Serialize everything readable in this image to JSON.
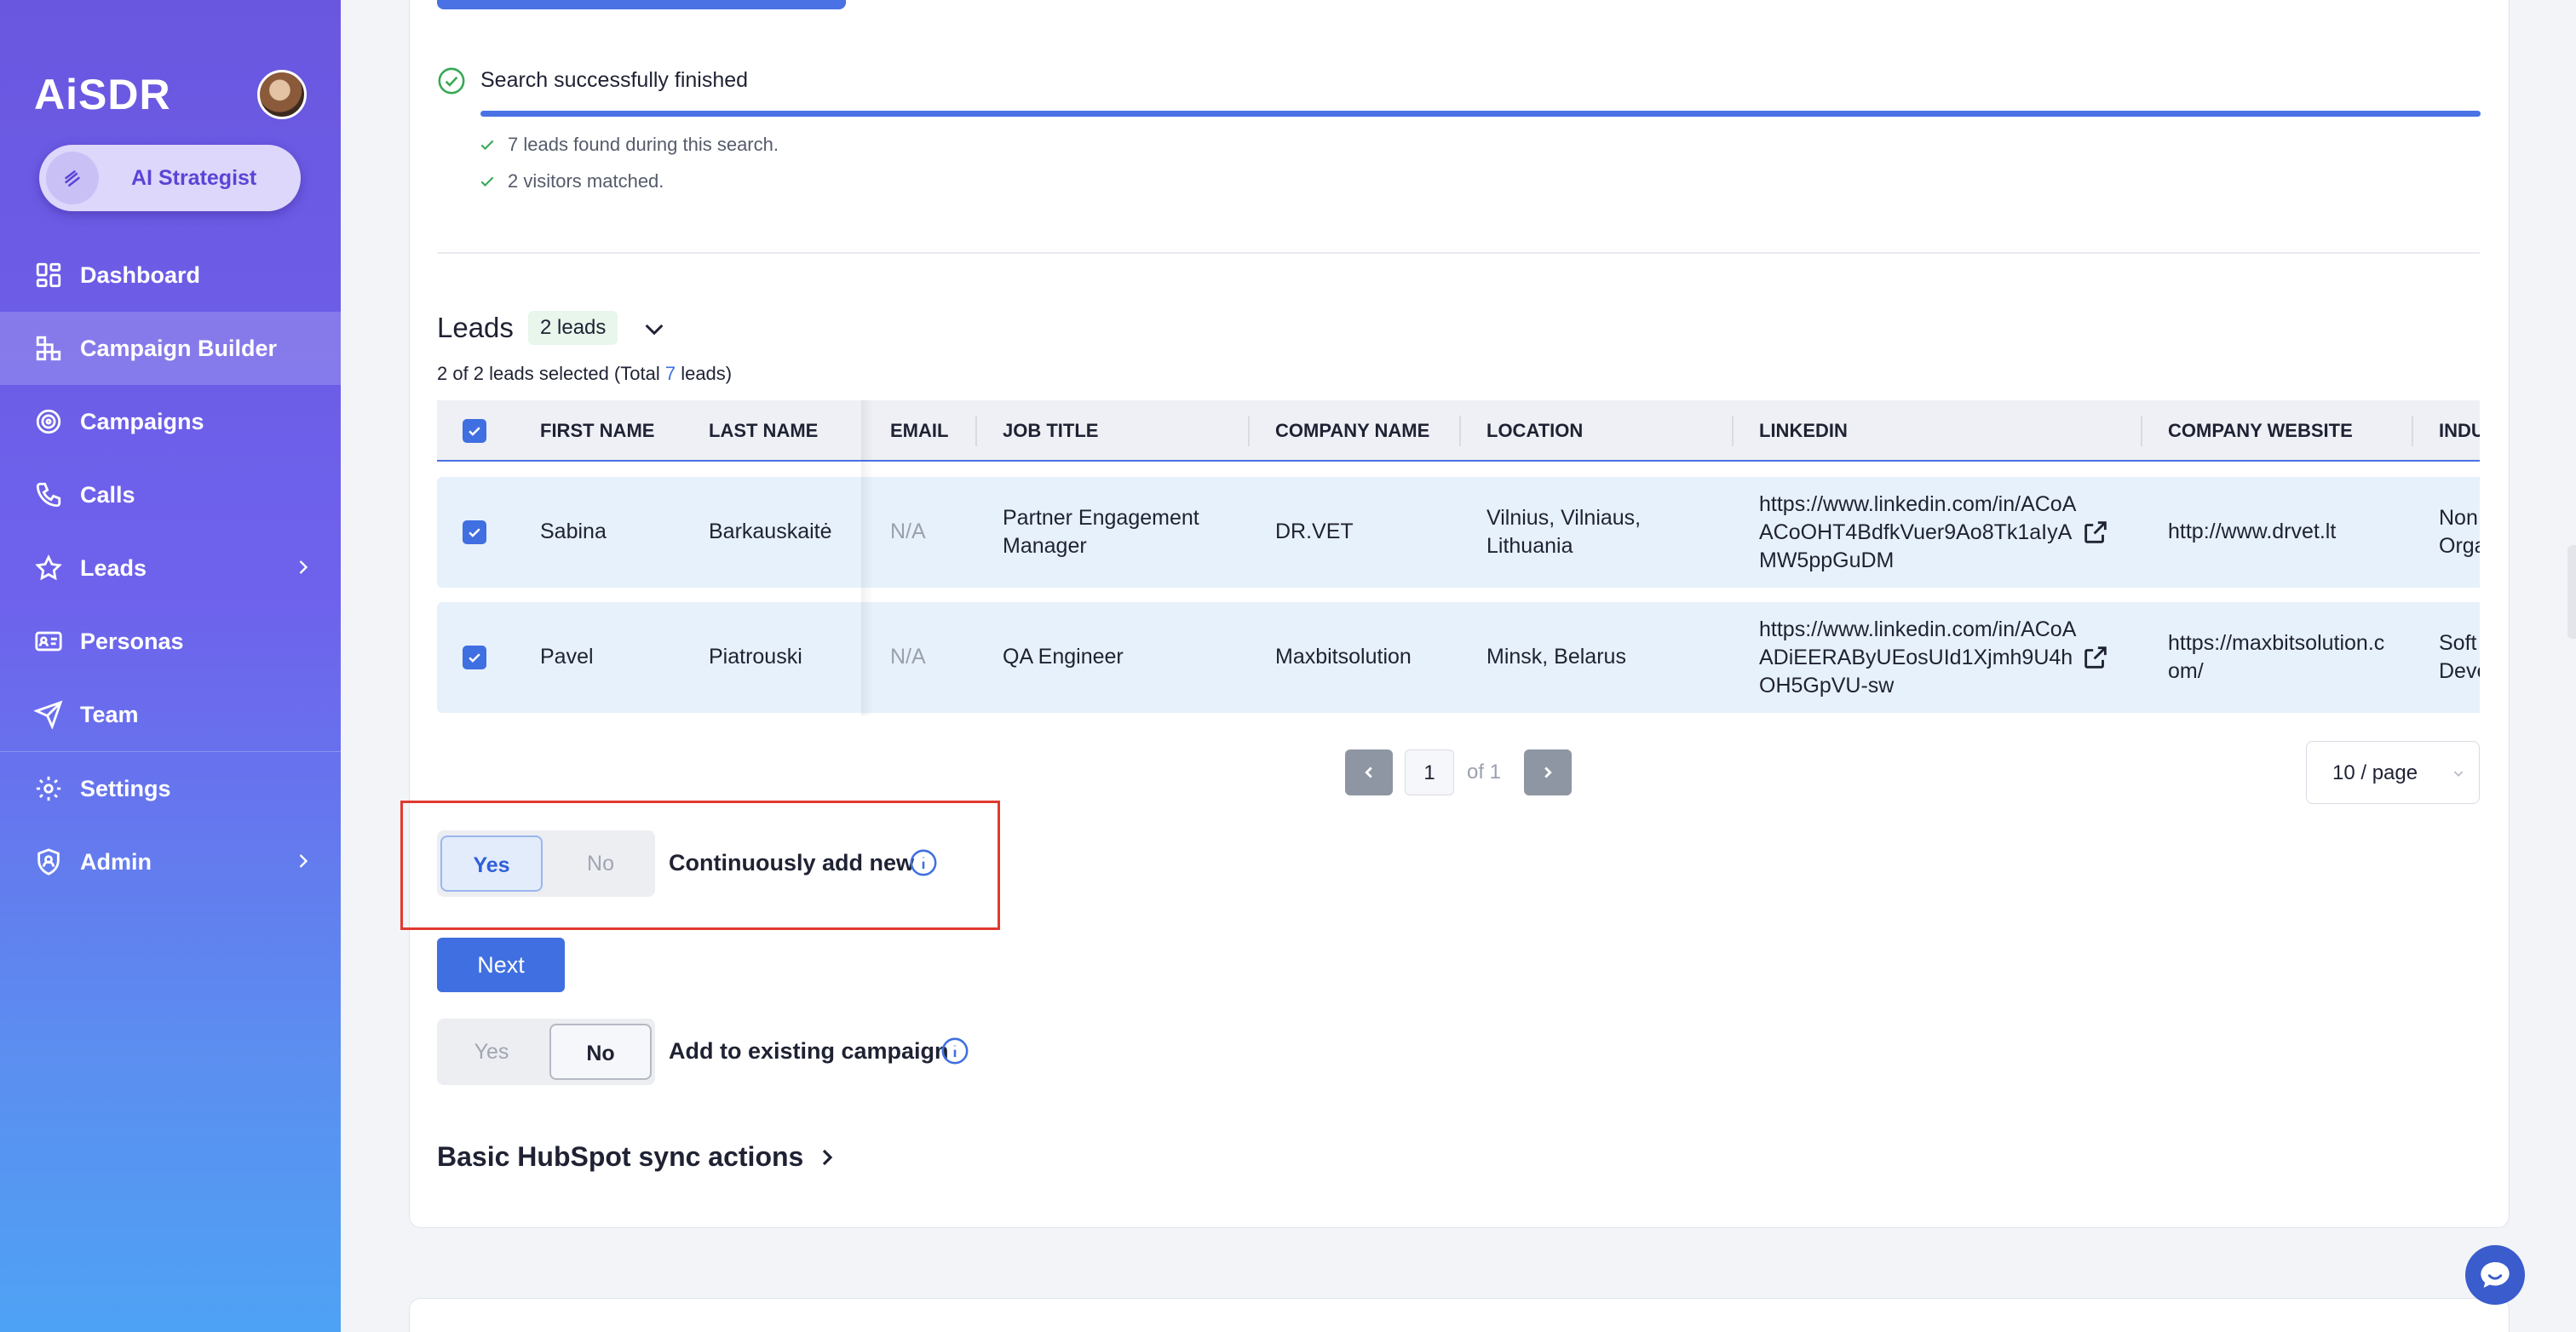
{
  "sidebar": {
    "logo": "AiSDR",
    "strategist_label": "AI Strategist",
    "items": [
      {
        "label": "Dashboard"
      },
      {
        "label": "Campaign Builder"
      },
      {
        "label": "Campaigns"
      },
      {
        "label": "Calls"
      },
      {
        "label": "Leads"
      },
      {
        "label": "Personas"
      },
      {
        "label": "Team"
      },
      {
        "label": "Settings"
      },
      {
        "label": "Admin"
      }
    ]
  },
  "search": {
    "status": "Search successfully finished",
    "progress_percent": 100,
    "results": [
      "7 leads found during this search.",
      "2 visitors matched."
    ]
  },
  "leads": {
    "title": "Leads",
    "badge": "2 leads",
    "selected_prefix": "2 of 2 leads selected (Total ",
    "selected_total": "7",
    "selected_suffix": " leads)",
    "columns": [
      "FIRST NAME",
      "LAST NAME",
      "EMAIL",
      "JOB TITLE",
      "COMPANY NAME",
      "LOCATION",
      "LINKEDIN",
      "COMPANY WEBSITE",
      "INDU"
    ],
    "rows": [
      {
        "first_name": "Sabina",
        "last_name": "Barkauskaitė",
        "email": "N/A",
        "job_title": "Partner Engagement Manager",
        "company": "DR.VET",
        "location": "Vilnius, Vilniaus, Lithuania",
        "linkedin": "https://www.linkedin.com/in/ACoAACoOHT4BdfkVuer9Ao8Tk1aIyAMW5ppGuDM",
        "website": "http://www.drvet.lt",
        "industry": "Non Orga"
      },
      {
        "first_name": "Pavel",
        "last_name": "Piatrouski",
        "email": "N/A",
        "job_title": "QA Engineer",
        "company": "Maxbitsolution",
        "location": "Minsk, Belarus",
        "linkedin": "https://www.linkedin.com/in/ACoAADiEERAByUEosUId1Xjmh9U4hOH5GpVU-sw",
        "website": "https://maxbitsolution.com/",
        "industry": "Soft Deve"
      }
    ]
  },
  "pagination": {
    "current": "1",
    "of_label": "of 1",
    "page_size": "10 / page"
  },
  "continuous": {
    "yes": "Yes",
    "no": "No",
    "selected": "Yes",
    "label": "Continuously add new"
  },
  "next_label": "Next",
  "existing": {
    "yes": "Yes",
    "no": "No",
    "selected": "No",
    "label": "Add to existing campaign"
  },
  "hubspot_label": "Basic HubSpot sync actions",
  "colors": {
    "accent": "#3f6fe0",
    "row_bg": "#e7f1fb",
    "highlight": "#e0392f"
  }
}
